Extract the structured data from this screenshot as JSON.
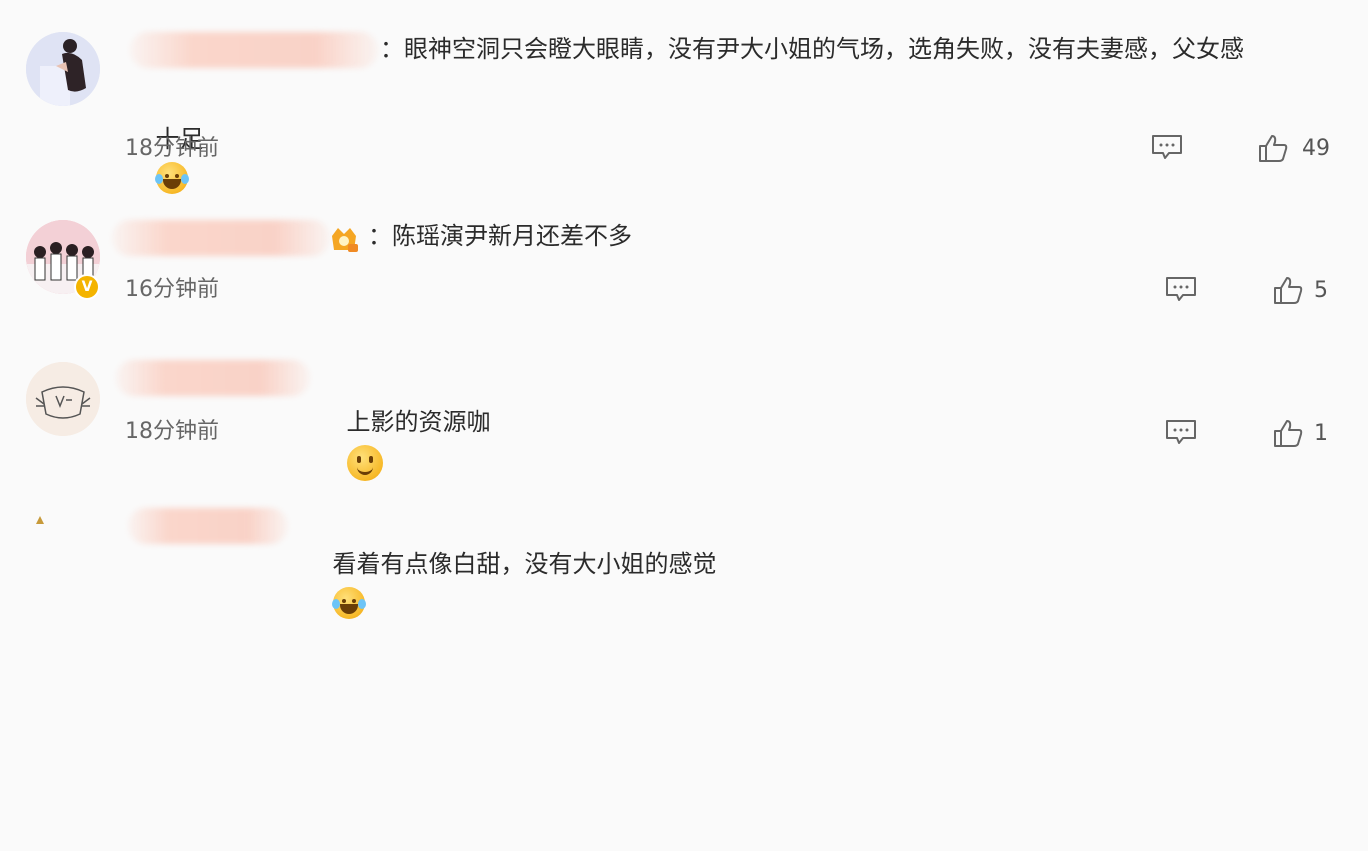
{
  "comments": [
    {
      "text_line1": "：眼神空洞只会瞪大眼睛，没有尹大小姐的气场，选角失败，没有夫妻感，父女感",
      "text_line2": "十足",
      "emoji": "laugh-cry-emoji",
      "time": "18分钟前",
      "likes": "49"
    },
    {
      "text_line1": "：陈瑶演尹新月还差不多",
      "time": "16分钟前",
      "likes": "5",
      "badge": "V"
    },
    {
      "text_line1": "上影的资源咖",
      "emoji": "smile-emoji",
      "time": "18分钟前",
      "likes": "1"
    },
    {
      "text_line1": "看着有点像白甜，没有大小姐的感觉",
      "emoji": "laugh-cry-emoji"
    }
  ]
}
